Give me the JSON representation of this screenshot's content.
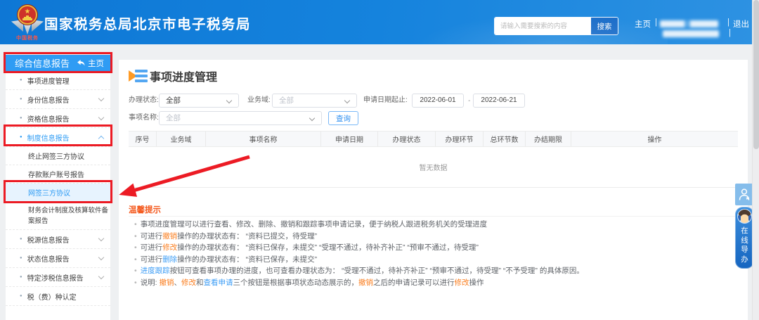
{
  "colors": {
    "accent": "#2f9cf4",
    "tip": "#f4581c",
    "orange": "#fa7d1e",
    "blue": "#3d9df5",
    "red": "#ec1b24"
  },
  "header": {
    "title": "国家税务总局北京市电子税务局",
    "emblem_caption": "中国税务",
    "search_placeholder": "请输入需要搜索的内容",
    "search_button": "搜索",
    "nav_home": "主页",
    "nav_sep": "|",
    "nav_logout": "退出"
  },
  "sidebar": {
    "header": {
      "label": "综合信息报告",
      "home_label": "主页"
    },
    "items": [
      {
        "label": "事项进度管理",
        "type": "plain"
      },
      {
        "label": "身份信息报告",
        "type": "collapsed"
      },
      {
        "label": "资格信息报告",
        "type": "collapsed"
      },
      {
        "label": "制度信息报告",
        "type": "expanded"
      },
      {
        "label": "终止网签三方协议",
        "type": "sub"
      },
      {
        "label": "存款账户账号报告",
        "type": "sub"
      },
      {
        "label": "网签三方协议",
        "type": "sub",
        "selected": true
      },
      {
        "label": "财务会计制度及核算软件备案报告",
        "type": "sub",
        "wrap": true
      },
      {
        "label": "税源信息报告",
        "type": "collapsed"
      },
      {
        "label": "状态信息报告",
        "type": "collapsed"
      },
      {
        "label": "特定涉税信息报告",
        "type": "collapsed"
      },
      {
        "label": "税（费）种认定",
        "type": "plain"
      }
    ]
  },
  "main": {
    "title": "事项进度管理",
    "filters": {
      "status_label": "办理状态:",
      "status_value": "全部",
      "domain_label": "业务域:",
      "domain_value": "全部",
      "date_label": "申请日期起止:",
      "date_from": "2022-06-01",
      "date_sep": "-",
      "date_to": "2022-06-21",
      "name_label": "事项名称:",
      "name_value": "全部",
      "query_button": "查询"
    },
    "table": {
      "columns": [
        "序号",
        "业务域",
        "事项名称",
        "申请日期",
        "办理状态",
        "办理环节",
        "总环节数",
        "办结期限",
        "操作"
      ],
      "empty_text": "暂无数据"
    },
    "tips": {
      "title": "温馨提示",
      "lines": [
        [
          {
            "t": "事项进度管理可以进行查看、修改、删除、撤销和跟踪事项申请记录，便于纳税人跟进税务机关的受理进度"
          }
        ],
        [
          {
            "t": "可进行"
          },
          {
            "t": "撤销",
            "c": "orange"
          },
          {
            "t": "操作的办理状态有： “资料已提交，待受理”"
          }
        ],
        [
          {
            "t": "可进行"
          },
          {
            "t": "修改",
            "c": "orange"
          },
          {
            "t": "操作的办理状态有： “资料已保存，未提交”  “受理不通过，待补齐补正”  “预审不通过，待受理”"
          }
        ],
        [
          {
            "t": "可进行"
          },
          {
            "t": "删除",
            "c": "blue"
          },
          {
            "t": "操作的办理状态有： “资料已保存，未提交”"
          }
        ],
        [
          {
            "t": "进度跟踪",
            "c": "blue"
          },
          {
            "t": "按钮可查看事项办理的进度，也可查看办理状态为： “受理不通过，待补齐补正”  “预审不通过，待受理”  “不予受理” 的具体原因。"
          }
        ],
        [
          {
            "t": "说明: "
          },
          {
            "t": "撤销",
            "c": "orange"
          },
          {
            "t": "、"
          },
          {
            "t": "修改",
            "c": "orange"
          },
          {
            "t": "和"
          },
          {
            "t": "查看申请",
            "c": "blue"
          },
          {
            "t": "三个按钮是根据事项状态动态展示的，"
          },
          {
            "t": "撤销",
            "c": "orange"
          },
          {
            "t": "之后的申请记录可以进行"
          },
          {
            "t": "修改",
            "c": "orange"
          },
          {
            "t": "操作"
          }
        ]
      ]
    }
  },
  "widgets": {
    "online_guide": "在线导办"
  }
}
